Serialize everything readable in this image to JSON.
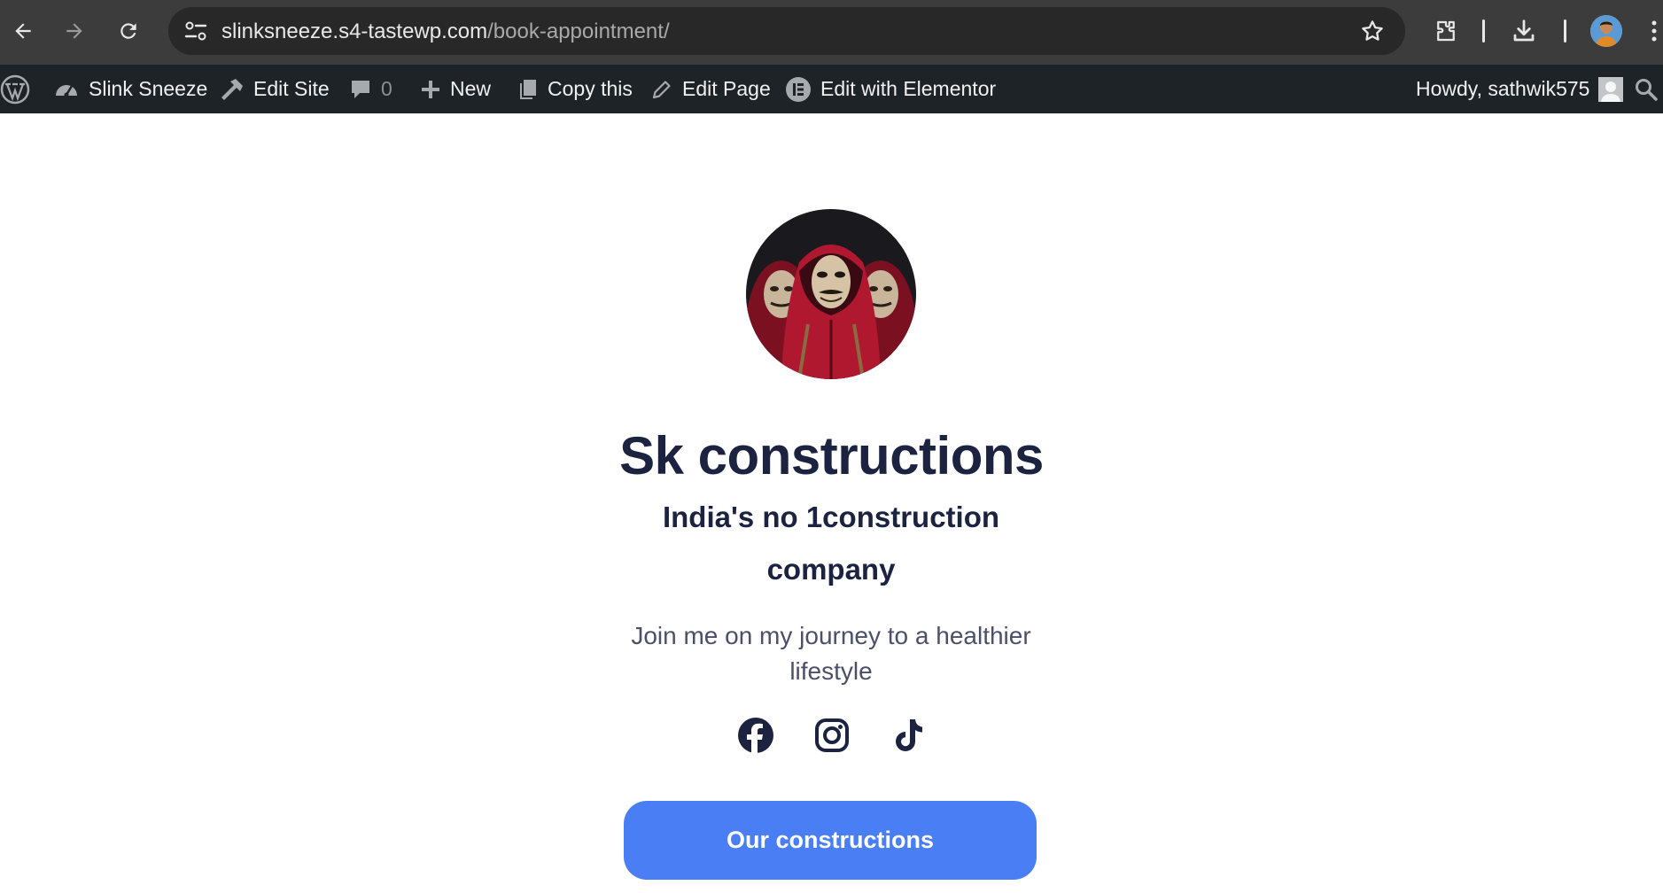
{
  "browser": {
    "url_host": "slinksneeze.s4-tastewp.com",
    "url_path": "/book-appointment/",
    "icons": [
      "back-arrow-icon",
      "forward-arrow-icon",
      "reload-icon",
      "site-info-icon",
      "bookmark-star-icon",
      "extensions-icon",
      "download-icon",
      "profile-avatar",
      "kebab-menu-icon"
    ]
  },
  "adminbar": {
    "site_name": "Slink Sneeze",
    "edit_site": "Edit Site",
    "comments_count": "0",
    "new": "New",
    "copy_this": "Copy this",
    "edit_page": "Edit Page",
    "edit_with_elementor": "Edit with Elementor",
    "howdy": "Howdy, sathwik575"
  },
  "page": {
    "title": "Sk constructions",
    "subtitle": "India's no 1construction company",
    "description": "Join me on my journey to a healthier lifestyle",
    "socials": [
      "facebook-icon",
      "instagram-icon",
      "tiktok-icon"
    ],
    "cta_label": "Our constructions"
  },
  "colors": {
    "heading": "#1c2340",
    "button": "#4a7ef5",
    "adminbar": "#1d2327",
    "chrome": "#3c3c3c"
  }
}
